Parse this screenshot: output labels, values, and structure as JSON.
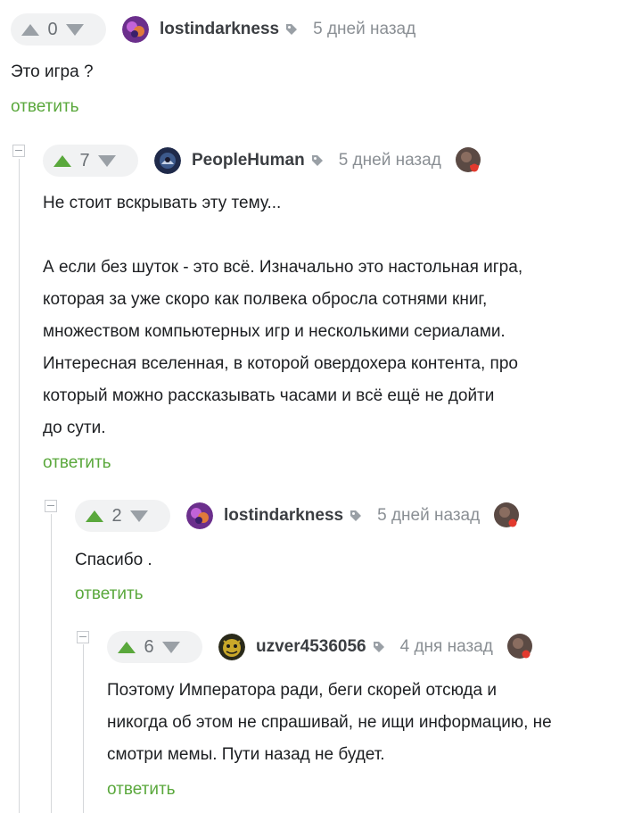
{
  "reply_label": "ответить",
  "comments": [
    {
      "score": "0",
      "author": "lostindarkness",
      "time": "5 дней назад",
      "text": "Это игра ?",
      "upvote_state": "neutral"
    },
    {
      "score": "7",
      "author": "PeopleHuman",
      "time": "5 дней назад",
      "text": "Не стоит вскрывать эту тему...\n\nА если без шуток - это всё. Изначально это настольная игра,\nкоторая за уже скоро как полвека обросла сотнями книг,\nмножеством компьютерных игр и несколькими сериалами.\nИнтересная вселенная, в которой овердохера контента, про\nкоторый можно рассказывать часами и всё ещё не дойти\nдо сути.",
      "upvote_state": "upvoted"
    },
    {
      "score": "2",
      "author": "lostindarkness",
      "time": "5 дней назад",
      "text": "Спасибо .",
      "upvote_state": "upvoted"
    },
    {
      "score": "6",
      "author": "uzver4536056",
      "time": "4 дня назад",
      "text": "Поэтому Императора ради, беги скорей отсюда и\nникогда об этом не спрашивай, не ищи информацию, не\nсмотри мемы. Пути назад не будет.",
      "upvote_state": "upvoted"
    }
  ],
  "colors": {
    "accent_green": "#5aa83c",
    "vote_bg": "#f1f2f3",
    "muted": "#8a8f94"
  },
  "icons": [
    "upvote-arrow-icon",
    "downvote-arrow-icon",
    "tag-icon",
    "heart-badge-icon",
    "collapse-icon"
  ]
}
